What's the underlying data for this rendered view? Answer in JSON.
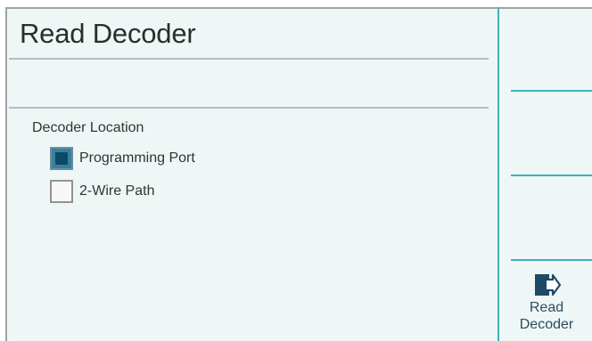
{
  "screen": {
    "title": "Read Decoder",
    "group_label": "Decoder Location",
    "options": [
      {
        "label": "Programming Port",
        "checked": true
      },
      {
        "label": "2-Wire Path",
        "checked": false
      }
    ]
  },
  "softkeys": {
    "read_decoder": {
      "label": "Read\nDecoder",
      "icon": "enter-arrow-icon"
    }
  },
  "colors": {
    "accent": "#3fb3b6",
    "checked_fill": "#0d4a66",
    "background": "#eef7f6"
  }
}
